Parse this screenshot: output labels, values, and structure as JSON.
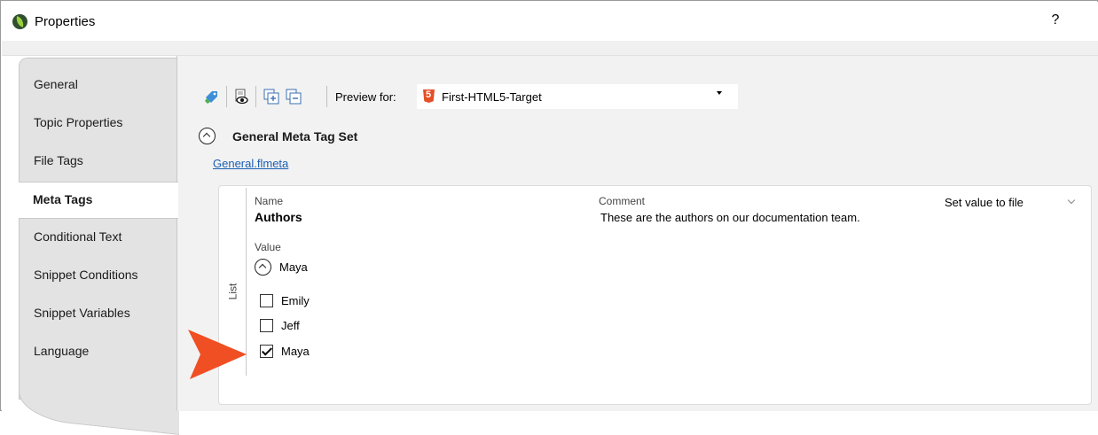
{
  "window": {
    "title": "Properties",
    "help_label": "?"
  },
  "tabs": [
    {
      "label": "General",
      "active": false
    },
    {
      "label": "Topic Properties",
      "active": false
    },
    {
      "label": "File Tags",
      "active": false
    },
    {
      "label": "Meta Tags",
      "active": true
    },
    {
      "label": "Conditional Text",
      "active": false
    },
    {
      "label": "Snippet Conditions",
      "active": false
    },
    {
      "label": "Snippet Variables",
      "active": false
    },
    {
      "label": "Language",
      "active": false
    }
  ],
  "toolbar": {
    "icons": [
      "tag-paint-icon",
      "preview-eye-icon",
      "expand-all-icon",
      "collapse-all-icon"
    ],
    "preview_label": "Preview for:",
    "preview_value": "First-HTML5-Target"
  },
  "meta_tag_set": {
    "title": "General Meta Tag Set",
    "file_link": "General.flmeta"
  },
  "meta_tag": {
    "name_label": "Name",
    "name_value": "Authors",
    "comment_label": "Comment",
    "comment_value": "These are the authors on our documentation team.",
    "action_value": "Set value to file",
    "value_label": "Value",
    "value_current": "Maya",
    "list_label": "List",
    "options": [
      {
        "label": "Emily",
        "checked": false
      },
      {
        "label": "Jeff",
        "checked": false
      },
      {
        "label": "Maya",
        "checked": true
      }
    ]
  },
  "colors": {
    "link": "#1a5fb4",
    "pointer_arrow": "#f04e23",
    "html5_badge": "#e34f26"
  }
}
